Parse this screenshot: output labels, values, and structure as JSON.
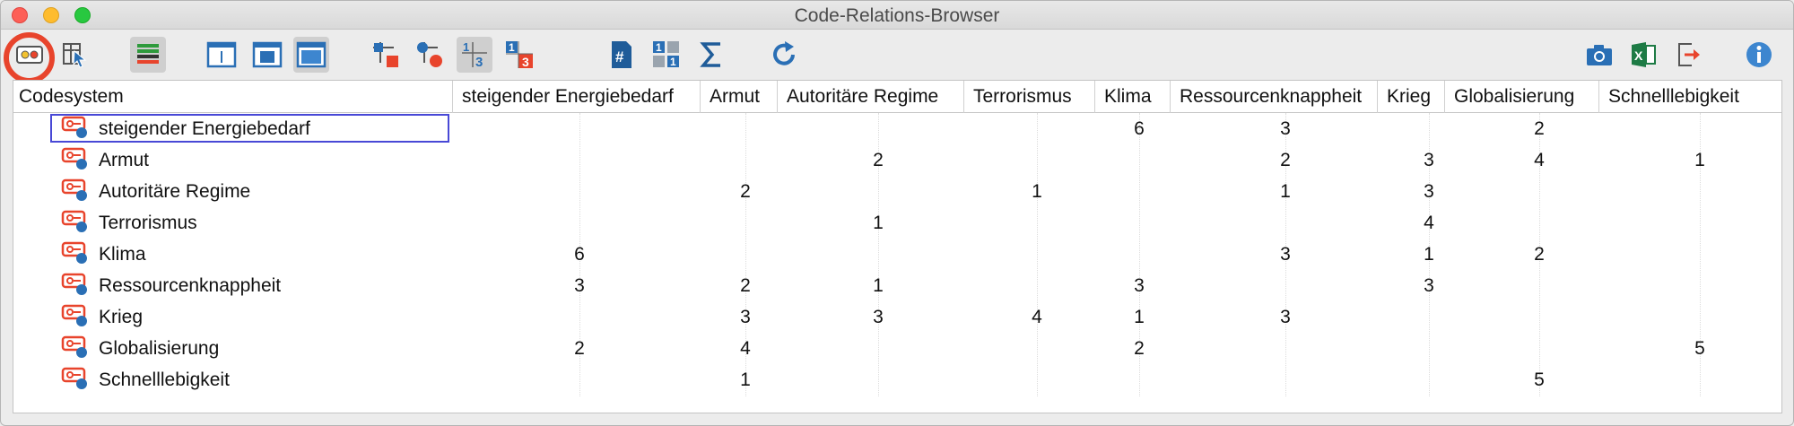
{
  "window": {
    "title": "Code-Relations-Browser"
  },
  "toolbar": {
    "left_icons": [
      "code-matrix-icon",
      "select-cursor-icon",
      "color-bars-icon",
      "panel-single-icon",
      "panel-middle-icon",
      "panel-filled-icon",
      "link-node-icon",
      "node-circle-icon",
      "count-1-3-icon",
      "count-red-1-3-icon",
      "hash-icon",
      "grid-numbers-icon",
      "sigma-icon",
      "refresh-icon"
    ],
    "right_icons": [
      "camera-icon",
      "excel-icon",
      "export-icon",
      "info-icon"
    ]
  },
  "table": {
    "corner_header": "Codesystem",
    "columns": [
      "steigender Energiebedarf",
      "Armut",
      "Autoritäre Regime",
      "Terrorismus",
      "Klima",
      "Ressourcenknappheit",
      "Krieg",
      "Globalisierung",
      "Schnelllebigkeit"
    ],
    "rows": [
      {
        "label": "steigender Energiebedarf",
        "values": [
          "",
          "",
          "",
          "",
          "6",
          "3",
          "",
          "2",
          ""
        ]
      },
      {
        "label": "Armut",
        "values": [
          "",
          "",
          "2",
          "",
          "",
          "2",
          "3",
          "4",
          "1"
        ]
      },
      {
        "label": "Autoritäre Regime",
        "values": [
          "",
          "2",
          "",
          "1",
          "",
          "1",
          "3",
          "",
          ""
        ]
      },
      {
        "label": "Terrorismus",
        "values": [
          "",
          "",
          "1",
          "",
          "",
          "",
          "4",
          "",
          ""
        ]
      },
      {
        "label": "Klima",
        "values": [
          "6",
          "",
          "",
          "",
          "",
          "3",
          "1",
          "2",
          ""
        ]
      },
      {
        "label": "Ressourcenknappheit",
        "values": [
          "3",
          "2",
          "1",
          "",
          "3",
          "",
          "3",
          "",
          ""
        ]
      },
      {
        "label": "Krieg",
        "values": [
          "",
          "3",
          "3",
          "4",
          "1",
          "3",
          "",
          "",
          ""
        ]
      },
      {
        "label": "Globalisierung",
        "values": [
          "2",
          "4",
          "",
          "",
          "2",
          "",
          "",
          "",
          "5"
        ]
      },
      {
        "label": "Schnelllebigkeit",
        "values": [
          "",
          "1",
          "",
          "",
          "",
          "",
          "",
          "5",
          ""
        ]
      }
    ]
  },
  "colors": {
    "accent_red": "#e8442c",
    "selection_border": "#4848d6",
    "icon_blue": "#2a6fb5"
  }
}
